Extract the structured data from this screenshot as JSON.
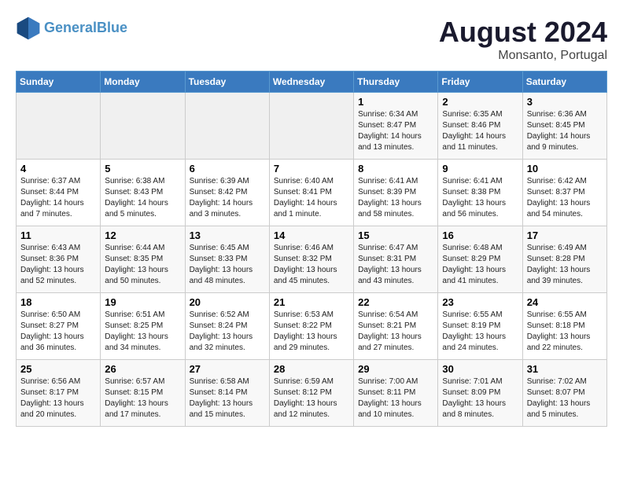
{
  "header": {
    "logo_line1": "General",
    "logo_line2": "Blue",
    "main_title": "August 2024",
    "subtitle": "Monsanto, Portugal"
  },
  "days_of_week": [
    "Sunday",
    "Monday",
    "Tuesday",
    "Wednesday",
    "Thursday",
    "Friday",
    "Saturday"
  ],
  "weeks": [
    [
      {
        "day": "",
        "info": ""
      },
      {
        "day": "",
        "info": ""
      },
      {
        "day": "",
        "info": ""
      },
      {
        "day": "",
        "info": ""
      },
      {
        "day": "1",
        "info": "Sunrise: 6:34 AM\nSunset: 8:47 PM\nDaylight: 14 hours\nand 13 minutes."
      },
      {
        "day": "2",
        "info": "Sunrise: 6:35 AM\nSunset: 8:46 PM\nDaylight: 14 hours\nand 11 minutes."
      },
      {
        "day": "3",
        "info": "Sunrise: 6:36 AM\nSunset: 8:45 PM\nDaylight: 14 hours\nand 9 minutes."
      }
    ],
    [
      {
        "day": "4",
        "info": "Sunrise: 6:37 AM\nSunset: 8:44 PM\nDaylight: 14 hours\nand 7 minutes."
      },
      {
        "day": "5",
        "info": "Sunrise: 6:38 AM\nSunset: 8:43 PM\nDaylight: 14 hours\nand 5 minutes."
      },
      {
        "day": "6",
        "info": "Sunrise: 6:39 AM\nSunset: 8:42 PM\nDaylight: 14 hours\nand 3 minutes."
      },
      {
        "day": "7",
        "info": "Sunrise: 6:40 AM\nSunset: 8:41 PM\nDaylight: 14 hours\nand 1 minute."
      },
      {
        "day": "8",
        "info": "Sunrise: 6:41 AM\nSunset: 8:39 PM\nDaylight: 13 hours\nand 58 minutes."
      },
      {
        "day": "9",
        "info": "Sunrise: 6:41 AM\nSunset: 8:38 PM\nDaylight: 13 hours\nand 56 minutes."
      },
      {
        "day": "10",
        "info": "Sunrise: 6:42 AM\nSunset: 8:37 PM\nDaylight: 13 hours\nand 54 minutes."
      }
    ],
    [
      {
        "day": "11",
        "info": "Sunrise: 6:43 AM\nSunset: 8:36 PM\nDaylight: 13 hours\nand 52 minutes."
      },
      {
        "day": "12",
        "info": "Sunrise: 6:44 AM\nSunset: 8:35 PM\nDaylight: 13 hours\nand 50 minutes."
      },
      {
        "day": "13",
        "info": "Sunrise: 6:45 AM\nSunset: 8:33 PM\nDaylight: 13 hours\nand 48 minutes."
      },
      {
        "day": "14",
        "info": "Sunrise: 6:46 AM\nSunset: 8:32 PM\nDaylight: 13 hours\nand 45 minutes."
      },
      {
        "day": "15",
        "info": "Sunrise: 6:47 AM\nSunset: 8:31 PM\nDaylight: 13 hours\nand 43 minutes."
      },
      {
        "day": "16",
        "info": "Sunrise: 6:48 AM\nSunset: 8:29 PM\nDaylight: 13 hours\nand 41 minutes."
      },
      {
        "day": "17",
        "info": "Sunrise: 6:49 AM\nSunset: 8:28 PM\nDaylight: 13 hours\nand 39 minutes."
      }
    ],
    [
      {
        "day": "18",
        "info": "Sunrise: 6:50 AM\nSunset: 8:27 PM\nDaylight: 13 hours\nand 36 minutes."
      },
      {
        "day": "19",
        "info": "Sunrise: 6:51 AM\nSunset: 8:25 PM\nDaylight: 13 hours\nand 34 minutes."
      },
      {
        "day": "20",
        "info": "Sunrise: 6:52 AM\nSunset: 8:24 PM\nDaylight: 13 hours\nand 32 minutes."
      },
      {
        "day": "21",
        "info": "Sunrise: 6:53 AM\nSunset: 8:22 PM\nDaylight: 13 hours\nand 29 minutes."
      },
      {
        "day": "22",
        "info": "Sunrise: 6:54 AM\nSunset: 8:21 PM\nDaylight: 13 hours\nand 27 minutes."
      },
      {
        "day": "23",
        "info": "Sunrise: 6:55 AM\nSunset: 8:19 PM\nDaylight: 13 hours\nand 24 minutes."
      },
      {
        "day": "24",
        "info": "Sunrise: 6:55 AM\nSunset: 8:18 PM\nDaylight: 13 hours\nand 22 minutes."
      }
    ],
    [
      {
        "day": "25",
        "info": "Sunrise: 6:56 AM\nSunset: 8:17 PM\nDaylight: 13 hours\nand 20 minutes."
      },
      {
        "day": "26",
        "info": "Sunrise: 6:57 AM\nSunset: 8:15 PM\nDaylight: 13 hours\nand 17 minutes."
      },
      {
        "day": "27",
        "info": "Sunrise: 6:58 AM\nSunset: 8:14 PM\nDaylight: 13 hours\nand 15 minutes."
      },
      {
        "day": "28",
        "info": "Sunrise: 6:59 AM\nSunset: 8:12 PM\nDaylight: 13 hours\nand 12 minutes."
      },
      {
        "day": "29",
        "info": "Sunrise: 7:00 AM\nSunset: 8:11 PM\nDaylight: 13 hours\nand 10 minutes."
      },
      {
        "day": "30",
        "info": "Sunrise: 7:01 AM\nSunset: 8:09 PM\nDaylight: 13 hours\nand 8 minutes."
      },
      {
        "day": "31",
        "info": "Sunrise: 7:02 AM\nSunset: 8:07 PM\nDaylight: 13 hours\nand 5 minutes."
      }
    ]
  ]
}
